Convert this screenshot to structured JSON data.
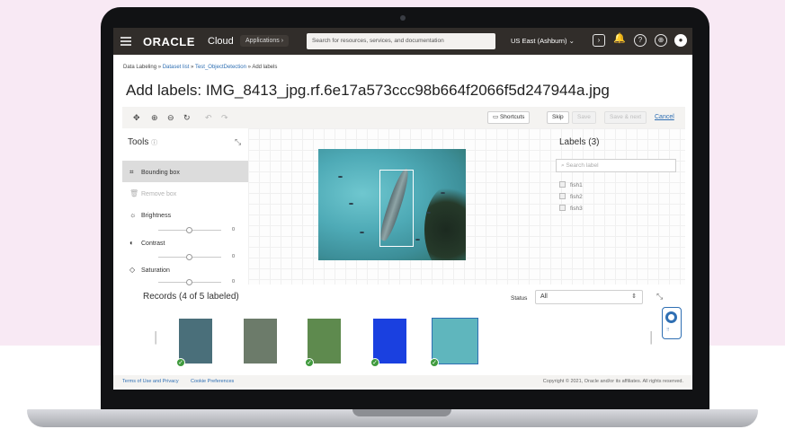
{
  "topnav": {
    "brand": "ORACLE",
    "brand_product": "Cloud",
    "applications_label": "Applications",
    "search_placeholder": "Search for resources, services, and documentation",
    "region": "US East (Ashburn)",
    "icons": [
      "menu-icon",
      "cloud-shell-icon",
      "notifications-icon",
      "help-icon",
      "language-icon",
      "user-icon"
    ]
  },
  "breadcrumb": {
    "root": "Data Labeling",
    "sep": " » ",
    "dataset_list": "Dataset list",
    "dataset": "Test_ObjectDetection",
    "current": "Add labels"
  },
  "page_title": "Add labels: IMG_8413_jpg.rf.6e17a573ccc98b664f2066f5d247944a.jpg",
  "toolbar": {
    "icons": [
      "move-icon",
      "zoom-in-icon",
      "zoom-out-icon",
      "reset-icon",
      "undo-icon",
      "redo-icon"
    ],
    "shortcuts_label": "Shortcuts",
    "skip_label": "Skip",
    "save_label": "Save",
    "save_next_label": "Save & next",
    "cancel_label": "Cancel"
  },
  "tools": {
    "title": "Tools",
    "bounding_box": "Bounding box",
    "remove_box": "Remove box",
    "brightness": "Brightness",
    "brightness_value": "0",
    "contrast": "Contrast",
    "contrast_value": "0",
    "saturation": "Saturation",
    "saturation_value": "0"
  },
  "labels": {
    "title": "Labels (3)",
    "search_placeholder": "Search label",
    "items": [
      "fish1",
      "fish2",
      "fish3"
    ]
  },
  "records": {
    "title": "Records (4 of 5 labeled)",
    "status_label": "Status",
    "status_value": "All",
    "thumbnails": [
      {
        "labeled": true,
        "selected": false,
        "color": "#4a6f7a"
      },
      {
        "labeled": false,
        "selected": false,
        "color": "#6c7b6a"
      },
      {
        "labeled": true,
        "selected": false,
        "color": "#5e8a4e"
      },
      {
        "labeled": true,
        "selected": false,
        "color": "#1a40e0"
      },
      {
        "labeled": true,
        "selected": true,
        "color": "#5fb6bd"
      }
    ],
    "check_glyph": "✓"
  },
  "footer": {
    "terms": "Terms of Use and Privacy",
    "cookies": "Cookie Preferences",
    "copyright": "Copyright © 2021, Oracle and/or its affiliates. All rights reserved."
  },
  "colors": {
    "nav_bg": "#312d2a",
    "link": "#2f6fb3",
    "labeled_check": "#3f9a3d",
    "background_pink": "#f8e9f4"
  }
}
